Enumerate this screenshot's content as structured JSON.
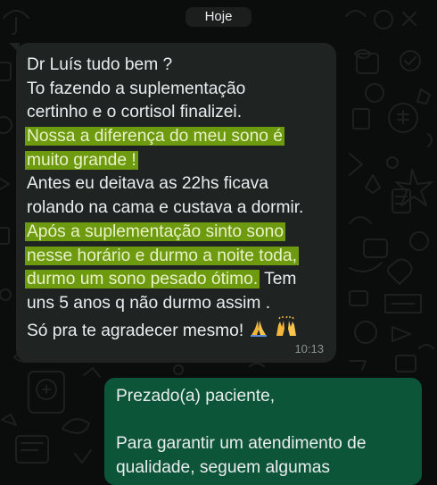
{
  "chat": {
    "day_label": "Hoje",
    "incoming": {
      "lines": [
        "Dr Luís tudo bem ?",
        "To fazendo a suplementação",
        "certinho e o cortisol finalizei.",
        "Nossa a diferença do meu sono é",
        "muito grande !",
        "Antes eu deitava as 22hs ficava",
        "rolando na cama e custava a dormir.",
        "Após a suplementação sinto sono",
        "nesse horário e durmo a noite toda,",
        "durmo um sono pesado ótimo.",
        " Tem",
        "uns 5 anos q não durmo assim .",
        "Só pra te agradecer mesmo!"
      ],
      "emojis": [
        "folded-hands-emoji",
        "raising-hands-emoji"
      ],
      "time": "10:13"
    },
    "outgoing": {
      "lines": [
        "Prezado(a) paciente,",
        "",
        "Para garantir um atendimento de",
        "qualidade, seguem algumas"
      ]
    }
  },
  "colors": {
    "background": "#0b0d0c",
    "incoming_bubble": "#1f2422",
    "outgoing_bubble": "#0d5538",
    "highlight": "#6e9a0f",
    "text": "#e9edef",
    "time": "#8a9490",
    "doodle": "#1a1d1c"
  }
}
